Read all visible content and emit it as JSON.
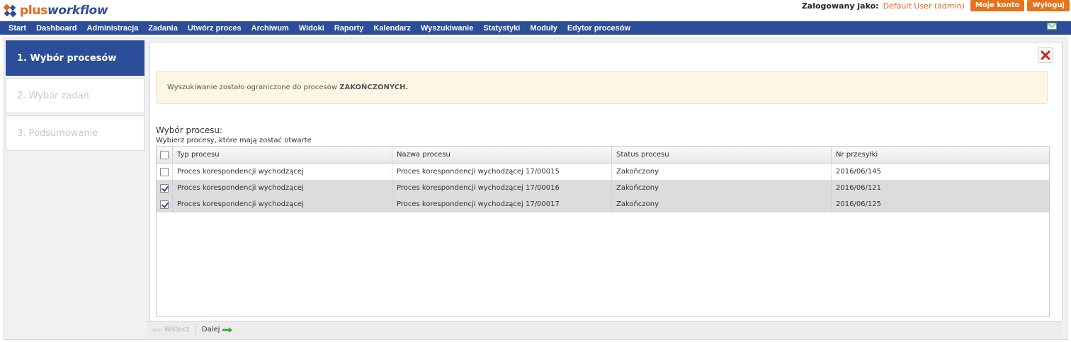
{
  "header": {
    "logo_plus": "plus",
    "logo_workflow": "workflow",
    "logged_in_label": "Zalogowany jako:",
    "user_name": "Default User (admin)",
    "my_account": "Moje konto",
    "logout": "Wyloguj"
  },
  "nav": [
    "Start",
    "Dashboard",
    "Administracja",
    "Zadania",
    "Utwórz proces",
    "Archiwum",
    "Widoki",
    "Raporty",
    "Kalendarz",
    "Wyszukiwanie",
    "Statystyki",
    "Moduły",
    "Edytor procesów"
  ],
  "steps": [
    "1. Wybór procesów",
    "2. Wybór zadań",
    "3. Podsumowanie"
  ],
  "notice": {
    "text": "Wyszukiwanie zostało ograniczone do procesów ",
    "emphasis": "ZAKOŃCZONYCH."
  },
  "section": {
    "title": "Wybór procesu:",
    "subtitle": "Wybierz procesy, które mają zostać otwarte"
  },
  "table": {
    "columns": [
      "Typ procesu",
      "Nazwa procesu",
      "Status procesu",
      "Nr przesyłki"
    ],
    "rows": [
      {
        "checked": false,
        "type": "Proces korespondencji wychodzącej",
        "name": "Proces korespondencji wychodzącej 17/00015",
        "status": "Zakończony",
        "number": "2016/06/145"
      },
      {
        "checked": true,
        "type": "Proces korespondencji wychodzącej",
        "name": "Proces korespondencji wychodzącej 17/00016",
        "status": "Zakończony",
        "number": "2016/06/121"
      },
      {
        "checked": true,
        "type": "Proces korespondencji wychodzącej",
        "name": "Proces korespondencji wychodzącej 17/00017",
        "status": "Zakończony",
        "number": "2016/06/125"
      }
    ]
  },
  "footer": {
    "back": "Wstecz",
    "next": "Dalej"
  },
  "colors": {
    "brand_blue": "#2c4e9a",
    "brand_orange": "#e8721c",
    "notice_bg": "#fdf6e4"
  },
  "icons": [
    "logo-icon",
    "mail-icon",
    "close-icon",
    "back-arrow-icon",
    "next-arrow-icon"
  ]
}
